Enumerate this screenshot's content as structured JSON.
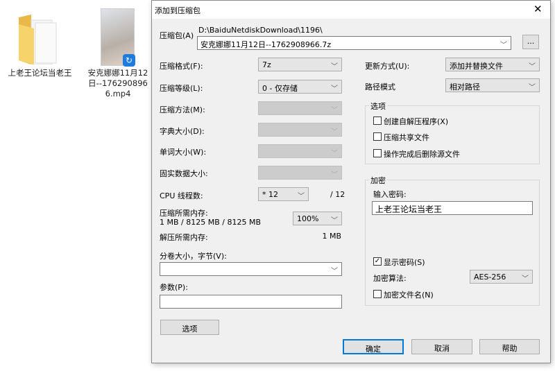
{
  "desktop": {
    "items": [
      {
        "label": "上老王论坛当老王",
        "type": "folder"
      },
      {
        "label": "安克娜娜11月12日--1762908966.mp4",
        "type": "video"
      }
    ]
  },
  "dialog": {
    "title": "添加到压缩包",
    "archive_label": "压缩包(A)",
    "archive_path": "D:\\BaiduNetdiskDownload\\1196\\",
    "archive_name": "安克娜娜11月12日--1762908966.7z",
    "browse_label": "...",
    "left": {
      "format_label": "压缩格式(F):",
      "format_value": "7z",
      "level_label": "压缩等级(L):",
      "level_value": "0 - 仅存储",
      "method_label": "压缩方法(M):",
      "dict_label": "字典大小(D):",
      "word_label": "单词大小(W):",
      "solid_label": "固实数据大小:",
      "cpu_label": "CPU 线程数:",
      "cpu_value": "* 12",
      "cpu_total": "/ 12",
      "mem_comp_label": "压缩所需内存:",
      "mem_comp_value": "1 MB / 8125 MB / 8125 MB",
      "mem_percent": "100%",
      "mem_decomp_label": "解压所需内存:",
      "mem_decomp_value": "1 MB",
      "volume_label": "分卷大小，字节(V):",
      "volume_value": "",
      "params_label": "参数(P):",
      "params_value": "",
      "options_button": "选项"
    },
    "right": {
      "update_label": "更新方式(U):",
      "update_value": "添加并替换文件",
      "path_label": "路径模式",
      "path_value": "相对路径",
      "options_group": "选项",
      "options": [
        {
          "label": "创建自解压程序(X)",
          "checked": false
        },
        {
          "label": "压缩共享文件",
          "checked": false
        },
        {
          "label": "操作完成后删除源文件",
          "checked": false
        }
      ],
      "encrypt_group": "加密",
      "password_label": "输入密码:",
      "password_value": "上老王论坛当老王",
      "show_password": {
        "label": "显示密码(S)",
        "checked": true
      },
      "algo_label": "加密算法:",
      "algo_value": "AES-256",
      "encrypt_names": {
        "label": "加密文件名(N)",
        "checked": false
      }
    },
    "buttons": {
      "ok": "确定",
      "cancel": "取消",
      "help": "帮助"
    }
  }
}
